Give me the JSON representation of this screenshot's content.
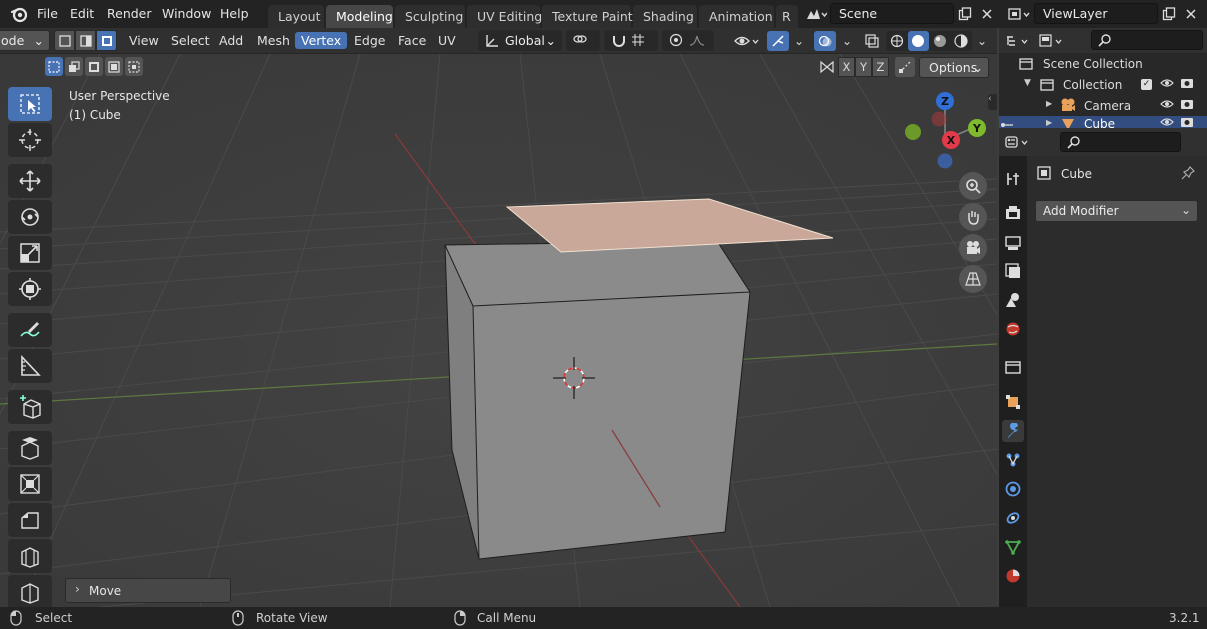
{
  "topbar": {
    "menus": [
      "File",
      "Edit",
      "Render",
      "Window",
      "Help"
    ],
    "workspaces": [
      "Layout",
      "Modeling",
      "Sculpting",
      "UV Editing",
      "Texture Paint",
      "Shading",
      "Animation",
      "R"
    ],
    "active_workspace": "Modeling",
    "scene": "Scene",
    "view_layer": "ViewLayer"
  },
  "viewport_header": {
    "mode": "ode",
    "menus": [
      "View",
      "Select",
      "Add",
      "Mesh",
      "Vertex",
      "Edge",
      "Face",
      "UV"
    ],
    "active_menu": "Vertex",
    "orientation": "Global",
    "axes": [
      "X",
      "Y",
      "Z"
    ],
    "options_label": "Options"
  },
  "viewport": {
    "view_name": "User Perspective",
    "object_label": "(1) Cube",
    "gizmo": {
      "z": "Z",
      "y": "Y",
      "x": "X"
    },
    "last_op": "Move"
  },
  "outliner": {
    "scene_collection": "Scene Collection",
    "items": [
      {
        "label": "Collection"
      },
      {
        "label": "Camera"
      },
      {
        "label": "Cube"
      }
    ]
  },
  "properties": {
    "object_name": "Cube",
    "add_modifier": "Add Modifier"
  },
  "statusbar": {
    "select": "Select",
    "rotate": "Rotate View",
    "call_menu": "Call Menu",
    "version": "3.2.1"
  },
  "colors": {
    "accent": "#4772b3",
    "face_selected": "#c9a89a",
    "cube": "#8c8c8c"
  }
}
